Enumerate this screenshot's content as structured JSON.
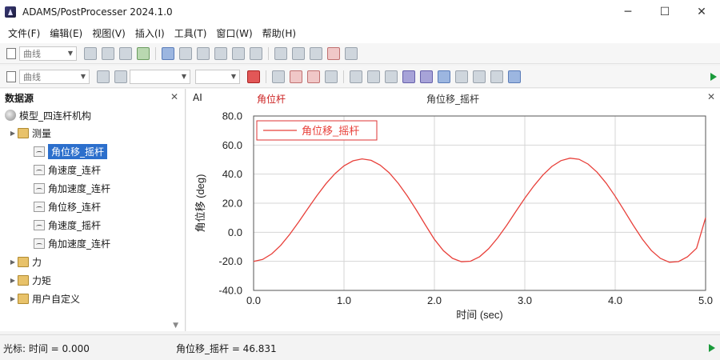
{
  "window": {
    "title": "ADAMS/PostProcesser 2024.1.0"
  },
  "menu": [
    "文件(F)",
    "编辑(E)",
    "视图(V)",
    "插入(I)",
    "工具(T)",
    "窗口(W)",
    "帮助(H)"
  ],
  "toolbar": {
    "combo1": "曲线",
    "combo2": "曲线"
  },
  "tree": {
    "header": "数据源",
    "model": "模型_四连杆机构",
    "measure_folder": "测量",
    "measures": [
      "角位移_摇杆",
      "角速度_连杆",
      "角加速度_连杆",
      "角位移_连杆",
      "角速度_摇杆",
      "角加速度_连杆"
    ],
    "selected_index": 0,
    "force_folder": "力",
    "torque_folder": "力矩",
    "user_folder": "用户自定义"
  },
  "plot": {
    "tab_label": "AI",
    "plot_title": "角位杆",
    "page_title": "角位移_摇杆"
  },
  "status": {
    "cursor": "光标:  时间 = 0.000",
    "value": "角位移_摇杆 = 46.831"
  },
  "chart_data": {
    "type": "line",
    "xlabel": "时间 (sec)",
    "ylabel": "角位移 (deg)",
    "xlim": [
      0,
      5
    ],
    "ylim": [
      -40,
      80
    ],
    "xticks": [
      "0.0",
      "1.0",
      "2.0",
      "3.0",
      "4.0",
      "5.0"
    ],
    "yticks": [
      "80.0",
      "60.0",
      "40.0",
      "20.0",
      "0.0",
      "-20.0",
      "-40.0"
    ],
    "grid": true,
    "legend_position": "top-left",
    "series": [
      {
        "name": "角位移_摇杆",
        "color": "#e8403a",
        "x": [
          0.0,
          0.1,
          0.2,
          0.3,
          0.4,
          0.5,
          0.6,
          0.7,
          0.8,
          0.9,
          1.0,
          1.1,
          1.2,
          1.3,
          1.4,
          1.5,
          1.6,
          1.7,
          1.8,
          1.9,
          2.0,
          2.1,
          2.2,
          2.3,
          2.4,
          2.5,
          2.6,
          2.7,
          2.8,
          2.9,
          3.0,
          3.1,
          3.2,
          3.3,
          3.4,
          3.5,
          3.6,
          3.7,
          3.8,
          3.9,
          4.0,
          4.1,
          4.2,
          4.3,
          4.4,
          4.5,
          4.6,
          4.7,
          4.8,
          4.9,
          5.0
        ],
        "y": [
          -20.0,
          -18.7,
          -14.9,
          -9.0,
          -1.4,
          7.2,
          16.3,
          25.2,
          33.4,
          40.3,
          45.7,
          49.2,
          50.5,
          49.5,
          46.2,
          40.9,
          33.7,
          25.0,
          15.3,
          5.1,
          -4.9,
          -12.7,
          -17.9,
          -20.3,
          -19.9,
          -16.8,
          -11.3,
          -3.9,
          4.8,
          14.2,
          23.4,
          31.9,
          39.4,
          45.3,
          49.3,
          51.0,
          50.2,
          46.9,
          41.3,
          33.8,
          24.8,
          14.9,
          4.8,
          -4.7,
          -12.6,
          -18.0,
          -20.6,
          -20.2,
          -16.9,
          -11.0,
          10.0
        ]
      }
    ]
  }
}
